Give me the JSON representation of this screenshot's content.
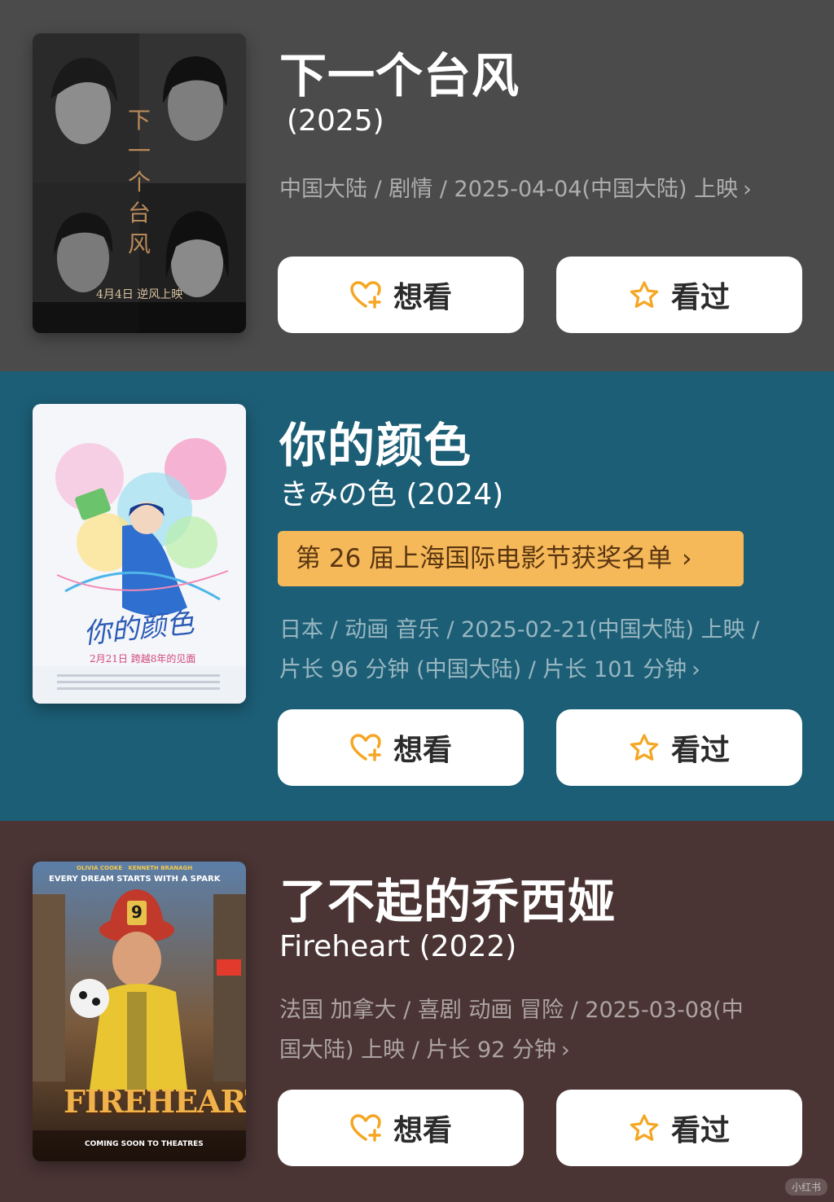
{
  "movies": [
    {
      "title": "下一个台风",
      "subtitle": "(2025)",
      "meta_lines": [
        "中国大陆 / 剧情 / 2025-04-04(中国大陆) 上映"
      ],
      "award": "",
      "poster": {
        "vertical_title": "下一个台风",
        "date_text": "4月4日 逆风上映"
      },
      "want_label": "想看",
      "seen_label": "看过"
    },
    {
      "title": "你的颜色",
      "subtitle": "きみの色 (2024)",
      "meta_lines": [
        "日本 / 动画 音乐 / 2025-02-21(中国大陆) 上映 /",
        "片长 96 分钟 (中国大陆) / 片长 101 分钟"
      ],
      "award": "第 26 届上海国际电影节获奖名单",
      "poster": {
        "script_title": "你的颜色",
        "date_text": "2月21日 跨越8年的见面"
      },
      "want_label": "想看",
      "seen_label": "看过"
    },
    {
      "title": "了不起的乔西娅",
      "subtitle": "Fireheart (2022)",
      "meta_lines": [
        "法国 加拿大 / 喜剧 动画 冒险 / 2025-03-08(中",
        "国大陆) 上映 / 片长 92 分钟"
      ],
      "award": "",
      "poster": {
        "names": "OLIVIA COOKE   KENNETH BRANAGH",
        "tagline": "EVERY DREAM STARTS WITH A SPARK",
        "logo": "FIREHEART",
        "footer": "COMING SOON TO THEATRES",
        "helmet_number": "9"
      },
      "want_label": "想看",
      "seen_label": "看过"
    }
  ],
  "colors": {
    "card1_bg": "#4b4b4b",
    "card2_bg": "#1c5e76",
    "card3_bg": "#4a3434",
    "award_bg": "#f6b95a",
    "icon_accent": "#f5a623"
  },
  "watermark": "小红书"
}
